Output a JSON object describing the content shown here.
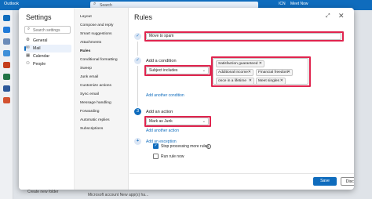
{
  "topbar": {
    "app_name": "Outlook",
    "search_placeholder": "Search",
    "right_items": [
      "ICN",
      "Meet Now"
    ]
  },
  "background": {
    "folder_action": "Create new folder",
    "preview_snippet": "Microsoft account New app(s) ha..."
  },
  "settings": {
    "title": "Settings",
    "search_placeholder": "Search settings",
    "categories": [
      {
        "label": "General",
        "icon": "gear-icon"
      },
      {
        "label": "Mail",
        "icon": "mail-icon",
        "selected": true
      },
      {
        "label": "Calendar",
        "icon": "calendar-icon"
      },
      {
        "label": "People",
        "icon": "people-icon"
      }
    ]
  },
  "mail_settings": {
    "items": [
      "Layout",
      "Compose and reply",
      "Smart suggestions",
      "Attachments",
      "Rules",
      "Conditional formatting",
      "Sweep",
      "Junk email",
      "Customize actions",
      "Sync email",
      "Message handling",
      "Forwarding",
      "Automatic replies",
      "Subscriptions"
    ],
    "selected": "Rules"
  },
  "rules": {
    "title": "Rules",
    "rule_name": "Move to spam",
    "condition_heading": "Add a condition",
    "condition_type": "Subject includes",
    "keywords": [
      "Satisfaction guaranteed",
      "Additional income",
      "Financial freedom",
      "once in a lifetime",
      "Meet singles"
    ],
    "add_another_condition": "Add another condition",
    "action_step_number": "3",
    "action_heading": "Add an action",
    "action_type": "Mark as Junk",
    "add_another_action": "Add another action",
    "add_exception": "Add an exception",
    "stop_processing_label": "Stop processing more rules",
    "stop_processing_checked": true,
    "run_rule_now_label": "Run rule now",
    "run_rule_now_checked": false,
    "save_label": "Save",
    "discard_label": "Discard"
  },
  "colors": {
    "accent": "#0f6cbd",
    "highlight": "#e0244e"
  }
}
